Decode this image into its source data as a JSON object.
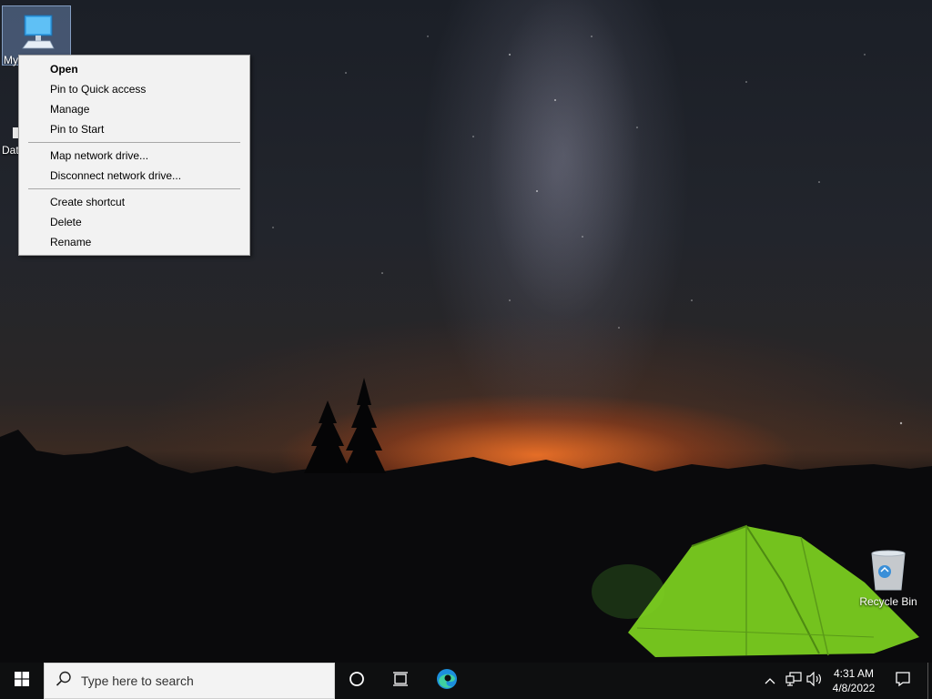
{
  "desktop": {
    "icons": [
      {
        "label": "My PC"
      },
      {
        "label": "Data"
      },
      {
        "label": "Recycle Bin"
      }
    ]
  },
  "context_menu": {
    "items": [
      {
        "label": "Open"
      },
      {
        "label": "Pin to Quick access"
      },
      {
        "label": "Manage"
      },
      {
        "label": "Pin to Start"
      },
      {
        "label": "Map network drive..."
      },
      {
        "label": "Disconnect network drive..."
      },
      {
        "label": "Create shortcut"
      },
      {
        "label": "Delete"
      },
      {
        "label": "Rename"
      }
    ]
  },
  "taskbar": {
    "search_placeholder": "Type here to search",
    "clock": {
      "time": "4:31 AM",
      "date": "4/8/2022"
    },
    "icons": {
      "start": "windows-logo-icon",
      "search": "search-icon",
      "cortana": "cortana-circle-icon",
      "task_view": "task-view-icon",
      "edge": "edge-browser-icon",
      "tray": "chevron-up-icon",
      "network": "network-icon",
      "volume": "volume-icon",
      "notifications": "notification-icon"
    }
  },
  "colors": {
    "taskbar_bg": "#0e0f10",
    "menu_bg": "#f2f2f2",
    "selection": "#7896c8",
    "tent_green": "#7ed321",
    "horizon_glow": "#ff7a2a"
  }
}
